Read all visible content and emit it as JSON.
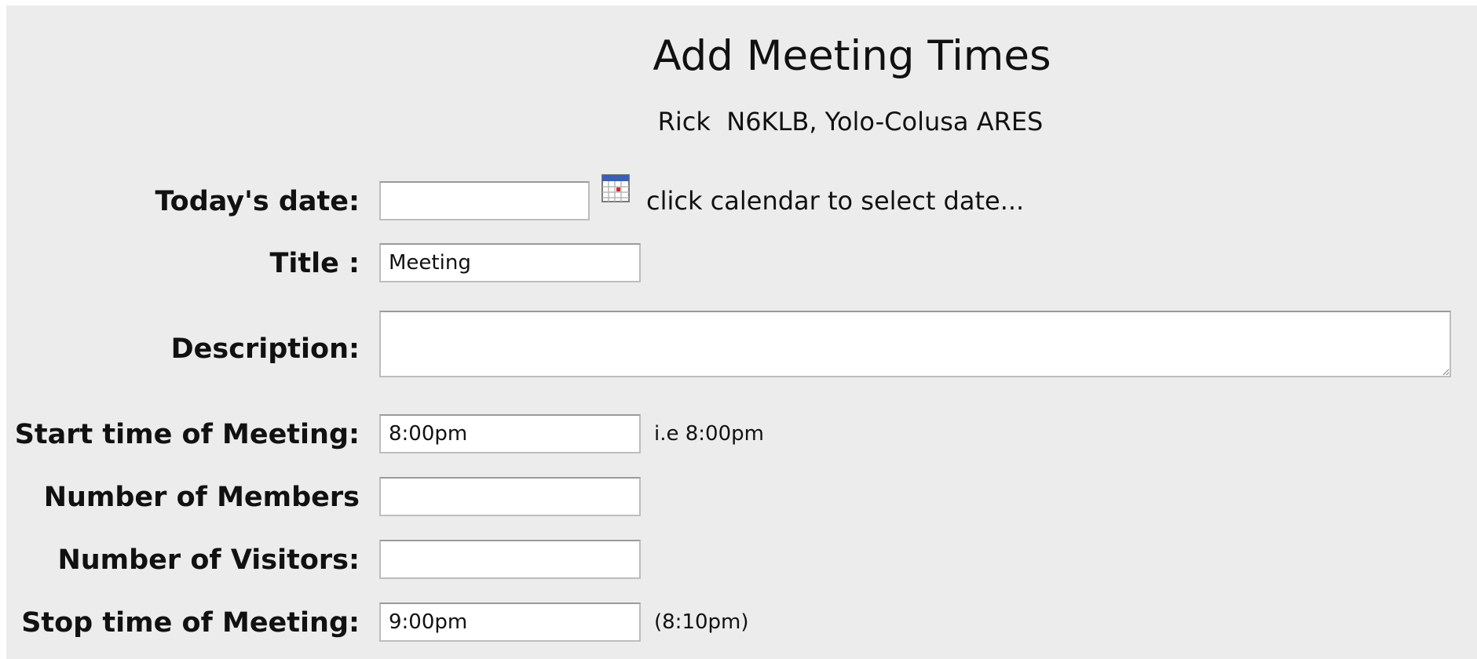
{
  "page": {
    "title": "Add Meeting Times",
    "subtitle": "Rick  N6KLB, Yolo-Colusa ARES"
  },
  "form": {
    "todays_date": {
      "label": "Today's date:",
      "value": "",
      "icon": "calendar-icon",
      "hint": "click calendar to select date..."
    },
    "title": {
      "label": "Title :",
      "value": "Meeting"
    },
    "description": {
      "label": "Description:",
      "value": ""
    },
    "start_time": {
      "label": "Start time of Meeting:",
      "value": "8:00pm",
      "hint": "i.e 8:00pm"
    },
    "members": {
      "label": "Number of Members",
      "value": ""
    },
    "visitors": {
      "label": "Number of Visitors:",
      "value": ""
    },
    "stop_time": {
      "label": "Stop time of Meeting:",
      "value": "9:00pm",
      "hint": "(8:10pm)"
    }
  },
  "colors": {
    "panel_background": "#ececec",
    "field_border": "#bdbdbd",
    "calendar_header": "#3b5fb6",
    "calendar_mark": "#d22b2b"
  }
}
